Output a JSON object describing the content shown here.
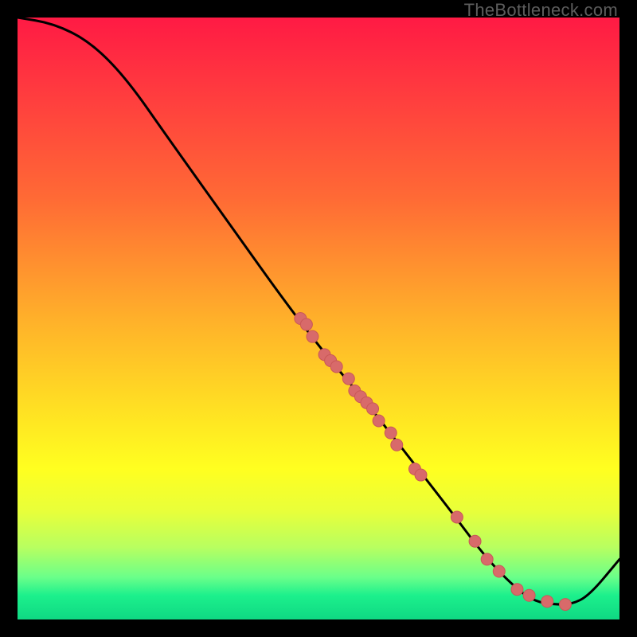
{
  "watermark": "TheBottleneck.com",
  "chart_data": {
    "type": "line",
    "title": "",
    "xlabel": "",
    "ylabel": "",
    "xlim": [
      0,
      100
    ],
    "ylim": [
      0,
      100
    ],
    "curve": [
      {
        "x": 0,
        "y": 100
      },
      {
        "x": 6,
        "y": 99
      },
      {
        "x": 12,
        "y": 96
      },
      {
        "x": 18,
        "y": 90
      },
      {
        "x": 25,
        "y": 80
      },
      {
        "x": 35,
        "y": 66
      },
      {
        "x": 45,
        "y": 52
      },
      {
        "x": 52,
        "y": 43
      },
      {
        "x": 58,
        "y": 36
      },
      {
        "x": 65,
        "y": 27
      },
      {
        "x": 72,
        "y": 18
      },
      {
        "x": 78,
        "y": 10
      },
      {
        "x": 83,
        "y": 5
      },
      {
        "x": 86,
        "y": 3
      },
      {
        "x": 89,
        "y": 2.5
      },
      {
        "x": 92,
        "y": 2.5
      },
      {
        "x": 95,
        "y": 4
      },
      {
        "x": 100,
        "y": 10
      }
    ],
    "points": [
      {
        "x": 47,
        "y": 50
      },
      {
        "x": 48,
        "y": 49
      },
      {
        "x": 49,
        "y": 47
      },
      {
        "x": 51,
        "y": 44
      },
      {
        "x": 52,
        "y": 43
      },
      {
        "x": 53,
        "y": 42
      },
      {
        "x": 55,
        "y": 40
      },
      {
        "x": 56,
        "y": 38
      },
      {
        "x": 57,
        "y": 37
      },
      {
        "x": 58,
        "y": 36
      },
      {
        "x": 59,
        "y": 35
      },
      {
        "x": 60,
        "y": 33
      },
      {
        "x": 62,
        "y": 31
      },
      {
        "x": 63,
        "y": 29
      },
      {
        "x": 66,
        "y": 25
      },
      {
        "x": 67,
        "y": 24
      },
      {
        "x": 73,
        "y": 17
      },
      {
        "x": 76,
        "y": 13
      },
      {
        "x": 78,
        "y": 10
      },
      {
        "x": 80,
        "y": 8
      },
      {
        "x": 83,
        "y": 5
      },
      {
        "x": 85,
        "y": 4
      },
      {
        "x": 88,
        "y": 3
      },
      {
        "x": 91,
        "y": 2.5
      }
    ],
    "colors": {
      "curve": "#000000",
      "point_fill": "#d86a6a",
      "point_stroke": "#c95858"
    }
  }
}
